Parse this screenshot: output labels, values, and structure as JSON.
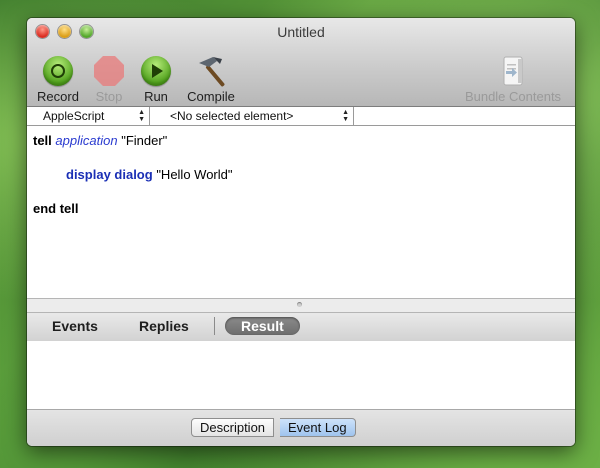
{
  "window": {
    "title": "Untitled"
  },
  "toolbar": {
    "record_label": "Record",
    "stop_label": "Stop",
    "run_label": "Run",
    "compile_label": "Compile",
    "bundle_label": "Bundle Contents"
  },
  "navbar": {
    "language": "AppleScript",
    "element": "<No selected element>"
  },
  "code": {
    "line1_kw": "tell",
    "line1_app": "application",
    "line1_str": "\"Finder\"",
    "line2_cmd": "display dialog",
    "line2_str": "\"Hello World\"",
    "line3_kw": "end tell"
  },
  "tabs": {
    "events": "Events",
    "replies": "Replies",
    "result": "Result"
  },
  "bottom": {
    "description": "Description",
    "event_log": "Event Log"
  },
  "colors": {
    "keyword_blue": "#1a2fb5",
    "application_blue": "#2a3bd0",
    "active_tab": "#7b7b7b",
    "selected_segment": "#9fc4ee"
  }
}
